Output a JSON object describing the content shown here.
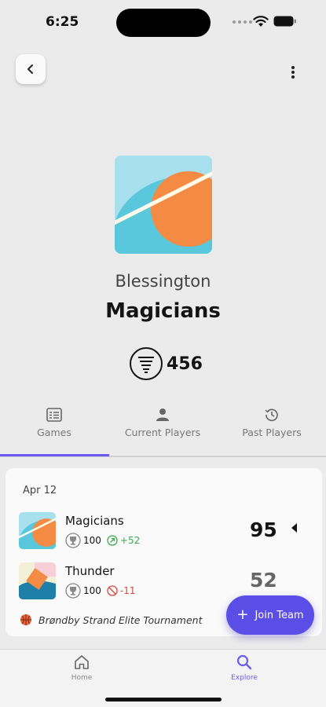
{
  "status_bar": {
    "time": "6:25"
  },
  "team": {
    "city": "Blessington",
    "name": "Magicians",
    "rating": "456"
  },
  "tabs": [
    {
      "label": "Games",
      "icon": "list-icon",
      "active": true
    },
    {
      "label": "Current Players",
      "icon": "person-icon",
      "active": false
    },
    {
      "label": "Past Players",
      "icon": "history-icon",
      "active": false
    }
  ],
  "game": {
    "date": "Apr 12",
    "home": {
      "name": "Magicians",
      "rating": "100",
      "delta": "+52",
      "score": "95",
      "winner": true
    },
    "away": {
      "name": "Thunder",
      "rating": "100",
      "delta": "-11",
      "score": "52",
      "winner": false
    },
    "tournament": "Brøndby Strand Elite Tournament"
  },
  "fab": {
    "label": "Join Team"
  },
  "nav": {
    "home": "Home",
    "explore": "Explore"
  },
  "colors": {
    "accent": "#5a4ee6",
    "positive": "#3aa84a",
    "negative": "#e0443e",
    "logo_orange": "#f48b45",
    "logo_blue": "#5ac8dc"
  }
}
